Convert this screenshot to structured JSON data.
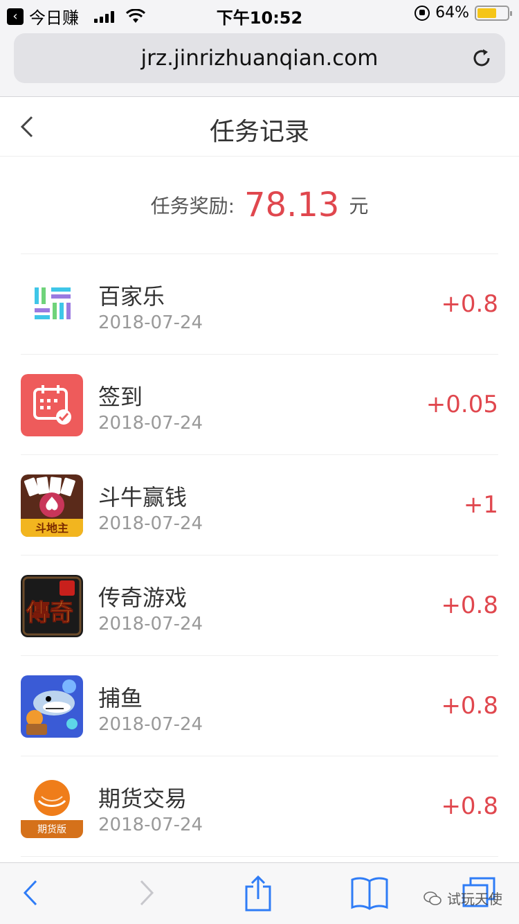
{
  "status_bar": {
    "back_app_label": "今日赚",
    "time": "下午10:52",
    "battery_text": "64%",
    "battery_level": 0.64
  },
  "browser": {
    "url": "jrz.jinrizhuanqian.com"
  },
  "header": {
    "title": "任务记录"
  },
  "reward": {
    "label": "任务奖励:",
    "value": "78.13",
    "unit": "元"
  },
  "tasks": [
    {
      "name": "百家乐",
      "date": "2018-07-24",
      "amount": "+0.8",
      "icon": "baijiale-app-icon"
    },
    {
      "name": "签到",
      "date": "2018-07-24",
      "amount": "+0.05",
      "icon": "calendar-checkin-icon"
    },
    {
      "name": "斗牛赢钱",
      "date": "2018-07-24",
      "amount": "+1",
      "icon": "poker-game-icon",
      "icon_text": "斗地主"
    },
    {
      "name": "传奇游戏",
      "date": "2018-07-24",
      "amount": "+0.8",
      "icon": "legend-game-icon",
      "icon_text": "傳奇"
    },
    {
      "name": "捕鱼",
      "date": "2018-07-24",
      "amount": "+0.8",
      "icon": "fishing-game-icon"
    },
    {
      "name": "期货交易",
      "date": "2018-07-24",
      "amount": "+0.8",
      "icon": "futures-app-icon",
      "icon_text": "期货版"
    }
  ],
  "watermark": {
    "text": "试玩天使"
  },
  "colors": {
    "accent_red": "#e0474e",
    "ios_blue": "#2f7cf6"
  }
}
